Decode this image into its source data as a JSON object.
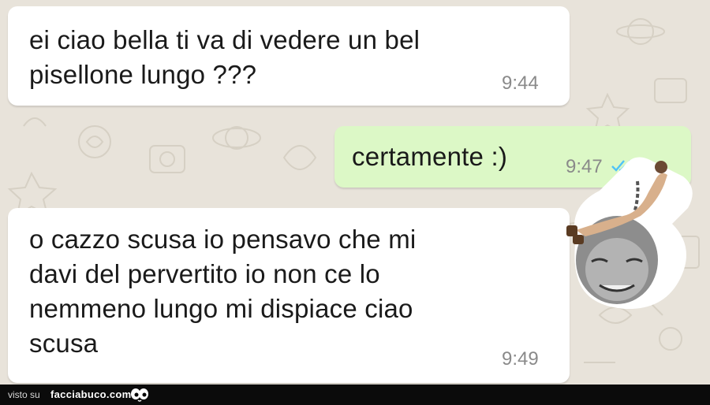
{
  "chat": {
    "messages": [
      {
        "direction": "incoming",
        "text": "ei ciao bella ti va di vedere un bel\npisellone lungo ???",
        "time": "9:44"
      },
      {
        "direction": "outgoing",
        "text": "certamente :)",
        "time": "9:47"
      },
      {
        "direction": "incoming",
        "text": "o cazzo scusa io pensavo che mi\ndavi del pervertito io non ce lo\nnemmeno lungo mi dispiace ciao\nscusa",
        "time": "9:49"
      }
    ]
  },
  "footer": {
    "visto_label": "visto su",
    "site": "facciabuco.com"
  },
  "colors": {
    "incoming_bubble": "#ffffff",
    "outgoing_bubble": "#dcf8c6",
    "wallpaper": "#e8e3da",
    "read_check": "#4fc3f7"
  },
  "icons": {
    "read_receipt": "double-check-icon",
    "footer_logo": "eyes-icon"
  }
}
